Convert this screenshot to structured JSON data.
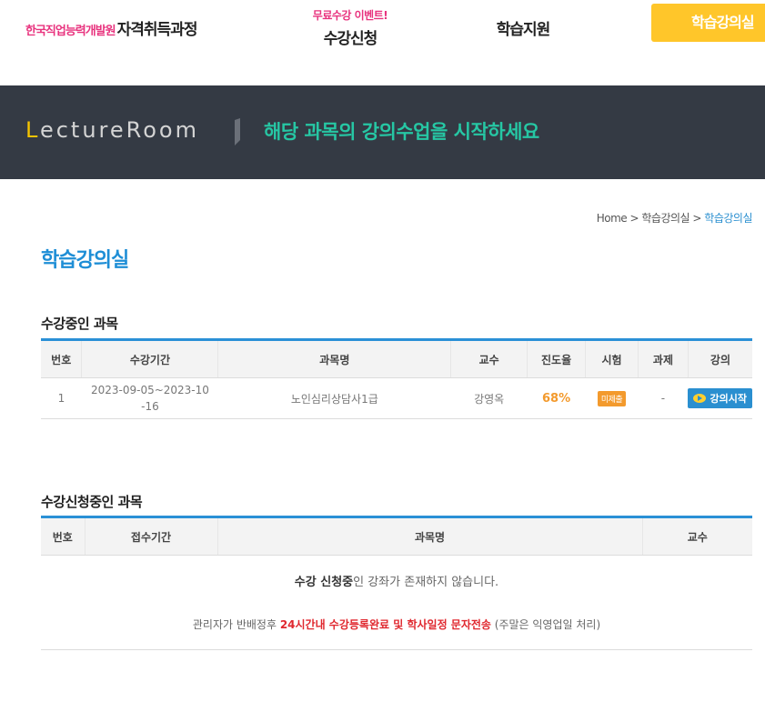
{
  "header": {
    "brand_org": "한국직업능력개발원",
    "brand_name": "자격취득과정",
    "nav": [
      {
        "event": "무료수강 이벤트!",
        "label": "수강신청"
      },
      {
        "event": "",
        "label": "학습지원"
      }
    ],
    "cta_label": "학습강의실",
    "cta_color": "#ffc62a"
  },
  "banner": {
    "logo_first": "L",
    "logo_rest": "ectureRoom",
    "message": "해당 과목의 강의수업을 시작하세요",
    "bg_color": "#343a44",
    "message_color": "#26c7a4"
  },
  "breadcrumb": {
    "home": "Home",
    "sep": ">",
    "level1": "학습강의실",
    "current": "학습강의실"
  },
  "page_title": "학습강의실",
  "enrolled": {
    "title": "수강중인 과목",
    "columns": [
      "번호",
      "수강기간",
      "과목명",
      "교수",
      "진도율",
      "시험",
      "과제",
      "강의"
    ],
    "rows": [
      {
        "no": "1",
        "period": "2023-09-05~2023-10-16",
        "course": "노인심리상담사1급",
        "professor": "강영옥",
        "progress": "68%",
        "exam": "미제출",
        "assignment": "-",
        "action": "강의시작"
      }
    ]
  },
  "applying": {
    "title": "수강신청중인 과목",
    "columns": [
      "번호",
      "접수기간",
      "과목명",
      "교수"
    ],
    "empty_bold": "수강 신청중",
    "empty_rest": "인 강좌가 존재하지 않습니다.",
    "notice_pre": "관리자가 반배정후 ",
    "notice_bold": "24시간내 수강등록완료 및 학사일정 문자전송",
    "notice_post": " (주말은 익영업일 처리)"
  },
  "accent_color": "#2a90d6"
}
